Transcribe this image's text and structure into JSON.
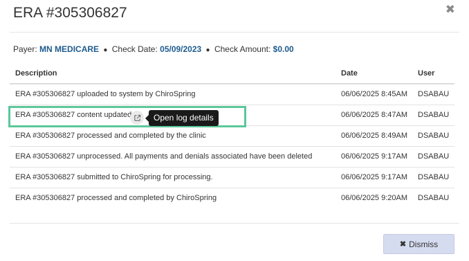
{
  "modal": {
    "title": "ERA #305306827",
    "close_glyph": "✖"
  },
  "meta": {
    "payer_label": "Payer:",
    "payer_value": "MN MEDICARE",
    "check_date_label": "Check Date:",
    "check_date_value": "05/09/2023",
    "check_amount_label": "Check Amount:",
    "check_amount_value": "$0.00",
    "separator": "●"
  },
  "table": {
    "headers": {
      "description": "Description",
      "date": "Date",
      "user": "User"
    },
    "rows": [
      {
        "description": "ERA #305306827 uploaded to system by ChiroSpring",
        "date": "06/06/2025 8:45AM",
        "user": "DSABAU"
      },
      {
        "description": "ERA #305306827 content updated",
        "date": "06/06/2025 8:47AM",
        "user": "DSABAU"
      },
      {
        "description": "ERA #305306827 processed and completed by the clinic",
        "date": "06/06/2025 8:49AM",
        "user": "DSABAU"
      },
      {
        "description": "ERA #305306827 unprocessed. All payments and denials associated have been deleted",
        "date": "06/06/2025 9:17AM",
        "user": "DSABAU"
      },
      {
        "description": "ERA #305306827 submitted to ChiroSpring for processing.",
        "date": "06/06/2025 9:17AM",
        "user": "DSABAU"
      },
      {
        "description": "ERA #305306827 processed and completed by ChiroSpring",
        "date": "06/06/2025 9:20AM",
        "user": "DSABAU"
      }
    ]
  },
  "tooltip": {
    "text": "Open log details"
  },
  "footer": {
    "dismiss_icon": "✖",
    "dismiss_label": "Dismiss"
  },
  "colors": {
    "accent_value": "#1d5b8e",
    "highlight": "#5cc79a",
    "dismiss_bg": "#d6dcef"
  },
  "icons": {
    "close": "close-icon",
    "external_link": "external-link-icon"
  }
}
